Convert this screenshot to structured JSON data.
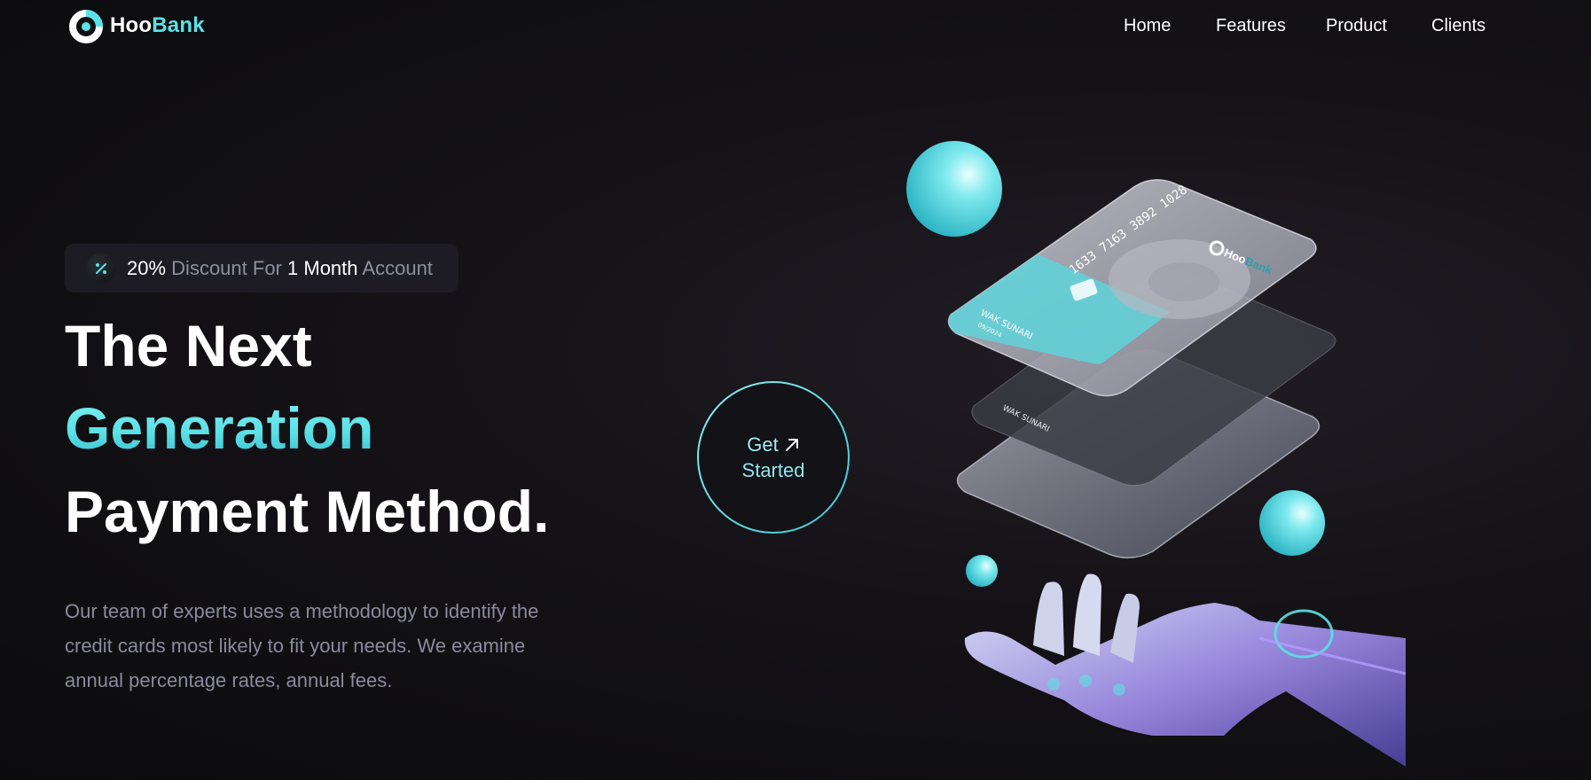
{
  "brand": {
    "name_part1": "Hoo",
    "name_part2": "Bank"
  },
  "nav": {
    "items": [
      "Home",
      "Features",
      "Product",
      "Clients"
    ]
  },
  "promo": {
    "pct": "20%",
    "discount": "Discount For",
    "duration": "1 Month",
    "account": "Account"
  },
  "hero": {
    "line1": "The Next",
    "line2": "Generation",
    "line3": "Payment Method.",
    "description": "Our team of experts uses a methodology to identify the credit cards most likely to fit your needs. We examine annual percentage rates, annual fees."
  },
  "cta": {
    "line1": "Get",
    "line2": "Started"
  },
  "card": {
    "number": "1633 7163 3892 1028",
    "holder": "WAK SUNARI",
    "expiry": "09/2024",
    "brand_part1": "Hoo",
    "brand_part2": "Bank"
  },
  "colors": {
    "accent": "#5ce1e6",
    "background": "#0b0b0d",
    "text_muted": "#8b8a9e"
  },
  "icons": {
    "promo": "discount-percent-icon",
    "cta": "arrow-up-right-icon",
    "logo": "hoobank-logo-icon"
  }
}
